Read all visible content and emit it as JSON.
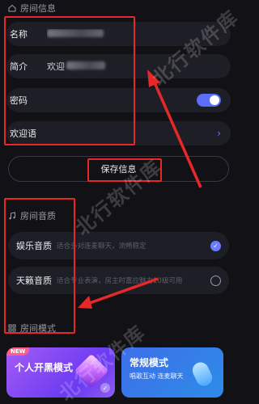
{
  "room_info": {
    "section_title": "房间信息",
    "name_label": "名称",
    "intro_label": "简介",
    "intro_prefix": "欢迎",
    "password_label": "密码",
    "password_enabled": true,
    "welcome_label": "欢迎语",
    "save_label": "保存信息"
  },
  "audio_quality": {
    "section_title": "房间音质",
    "options": [
      {
        "name": "娱乐音质",
        "desc": "适合多对连麦聊天，流畅稳定",
        "selected": true
      },
      {
        "name": "天籁音质",
        "desc": "适合专业表演，房主时富应魅力10级可用",
        "selected": false
      }
    ]
  },
  "room_mode": {
    "section_title": "房间模式",
    "cards": [
      {
        "title": "个人开黑模式",
        "subtitle": "",
        "badge": "NEW"
      },
      {
        "title": "常规模式",
        "subtitle": "唱歌互动 连麦聊天",
        "badge": ""
      }
    ]
  },
  "watermark": "北行软件库",
  "colors": {
    "accent": "#6d7bff",
    "annotation": "#e62828",
    "background": "#111116"
  }
}
